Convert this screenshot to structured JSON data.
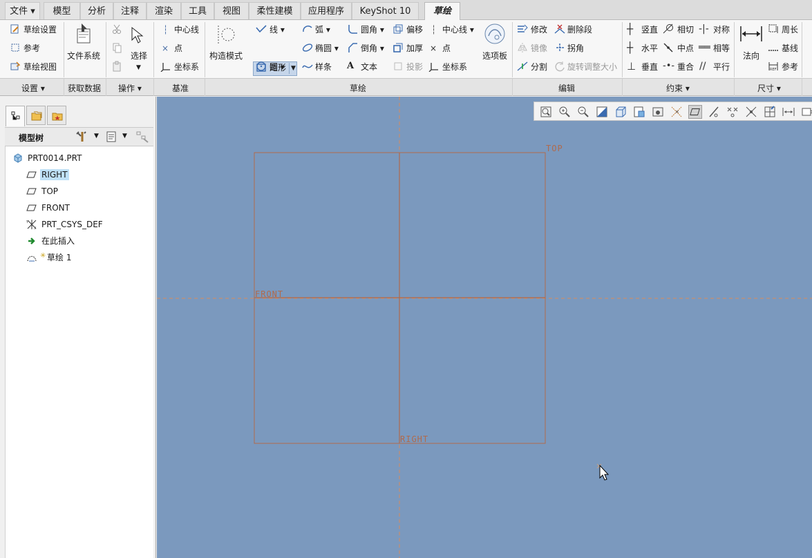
{
  "tabs": {
    "file": "文件",
    "items": [
      "模型",
      "分析",
      "注释",
      "渲染",
      "工具",
      "视图",
      "柔性建模",
      "应用程序",
      "KeyShot 10",
      "草绘"
    ],
    "active": "草绘"
  },
  "ribbon": {
    "setup": {
      "sketch_setup": "草绘设置",
      "reference": "参考",
      "sketch_view": "草绘视图"
    },
    "get_data": {
      "file_system": "文件系统"
    },
    "operations": {
      "select": "选择"
    },
    "datum": {
      "centerline": "中心线",
      "point": "点",
      "coord_sys": "坐标系"
    },
    "construction_mode": "构造模式",
    "sketching": {
      "line": "线",
      "rectangle": "矩形",
      "circle": "圆",
      "arc": "弧",
      "ellipse": "椭圆",
      "spline": "样条",
      "fillet": "圆角",
      "chamfer": "倒角",
      "text": "文本",
      "offset": "偏移",
      "thicken": "加厚",
      "project": "投影",
      "centerline": "中心线",
      "point": "点",
      "coord_sys": "坐标系"
    },
    "palette": "选项板",
    "editing": {
      "modify": "修改",
      "delete_segment": "删除段",
      "mirror": "镜像",
      "corner": "拐角",
      "divide": "分割",
      "rotate_resize": "旋转调整大小"
    },
    "constrain": {
      "vertical": "竖直",
      "tangent": "相切",
      "symmetric": "对称",
      "horizontal": "水平",
      "midpoint": "中点",
      "equal": "相等",
      "perpendicular": "垂直",
      "coincident": "重合",
      "parallel": "平行"
    },
    "normal": "法向",
    "dimension": {
      "perimeter": "周长",
      "baseline": "基线",
      "reference": "参考"
    },
    "group_labels": {
      "setup": "设置",
      "get_data": "获取数据",
      "operations": "操作",
      "datum": "基准",
      "sketching": "草绘",
      "editing": "编辑",
      "constrain": "约束",
      "dimension": "尺寸"
    }
  },
  "model_tree": {
    "header": "模型树",
    "root": "PRT0014.PRT",
    "items": [
      {
        "label": "RIGHT",
        "icon": "datum-plane-icon",
        "selected": true
      },
      {
        "label": "TOP",
        "icon": "datum-plane-icon",
        "selected": false
      },
      {
        "label": "FRONT",
        "icon": "datum-plane-icon",
        "selected": false
      },
      {
        "label": "PRT_CSYS_DEF",
        "icon": "coordinate-system-icon",
        "selected": false
      },
      {
        "label": "在此插入",
        "icon": "insert-here-arrow-icon",
        "selected": false
      },
      {
        "label": "草绘 1",
        "icon": "sketch-feature-icon",
        "selected": false
      }
    ]
  },
  "canvas": {
    "plane_labels": {
      "top": "TOP",
      "front": "FRONT",
      "right": "RIGHT"
    },
    "colors": {
      "background": "#7b99be",
      "plane": "#b06a4c",
      "ref_line": "#d98a5c"
    }
  }
}
